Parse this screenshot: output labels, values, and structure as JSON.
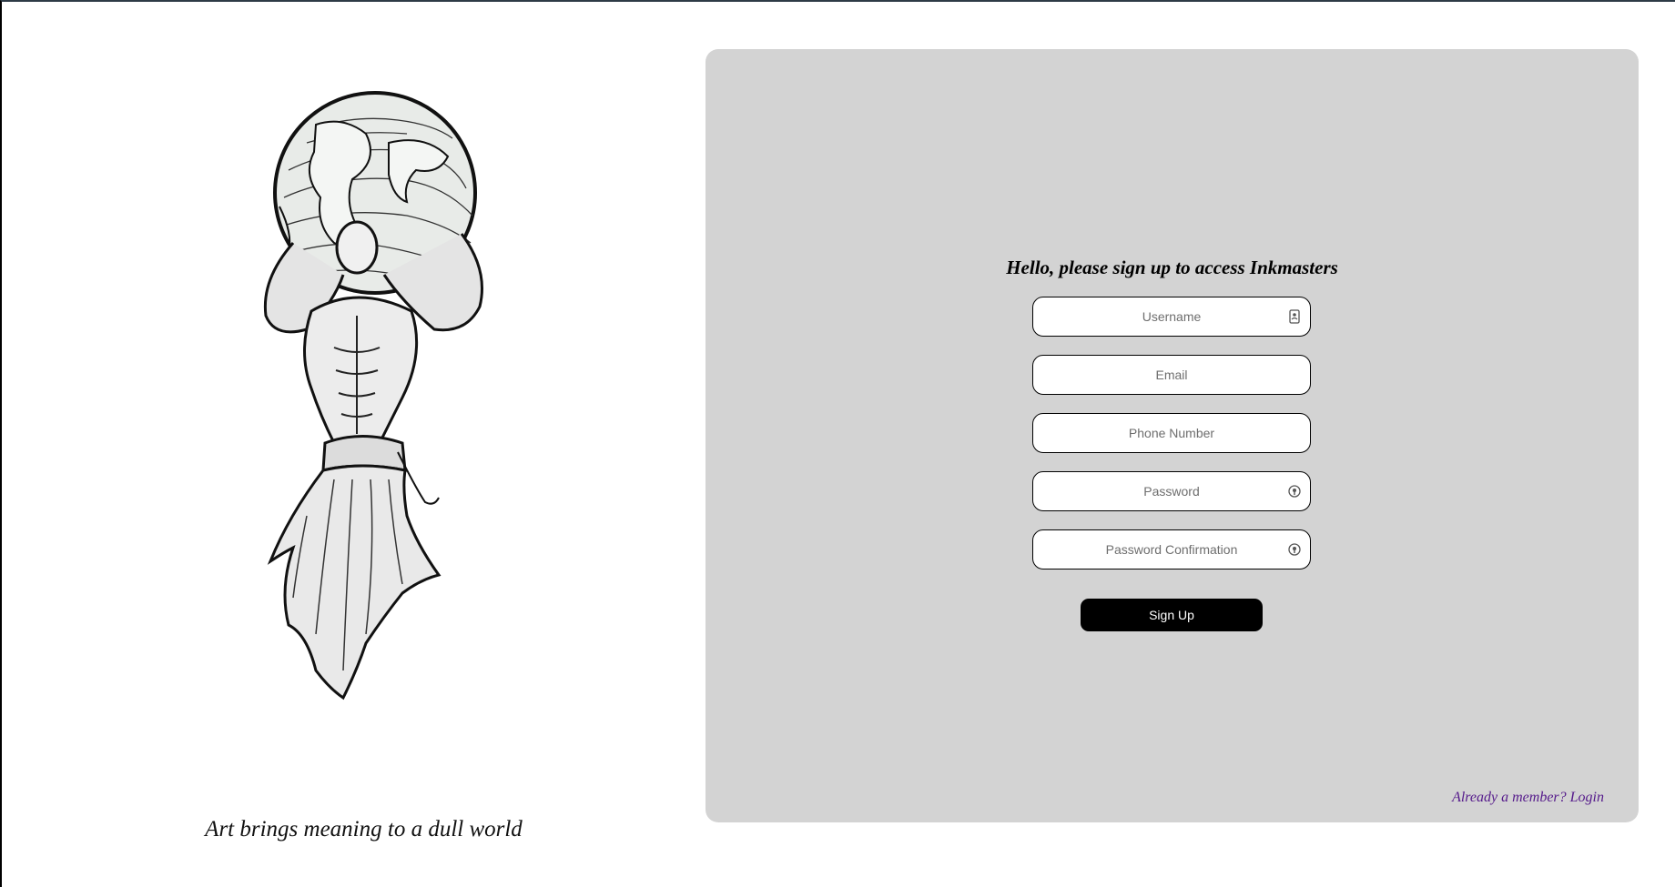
{
  "left_panel": {
    "illustration": "atlas-holding-globe-sketch",
    "tagline": "Art brings meaning to a dull world"
  },
  "form": {
    "title": "Hello, please sign up to access Inkmasters",
    "fields": {
      "username": {
        "placeholder": "Username",
        "icon": "contact-card-icon"
      },
      "email": {
        "placeholder": "Email"
      },
      "phone": {
        "placeholder": "Phone Number"
      },
      "password": {
        "placeholder": "Password",
        "icon": "password-key-icon"
      },
      "password_confirmation": {
        "placeholder": "Password Confirmation",
        "icon": "password-key-icon"
      }
    },
    "submit_label": "Sign Up",
    "login_link": "Already a member? Login"
  },
  "colors": {
    "card_background": "#d3d3d3",
    "button_background": "#000000",
    "link_color": "#551a8b"
  }
}
